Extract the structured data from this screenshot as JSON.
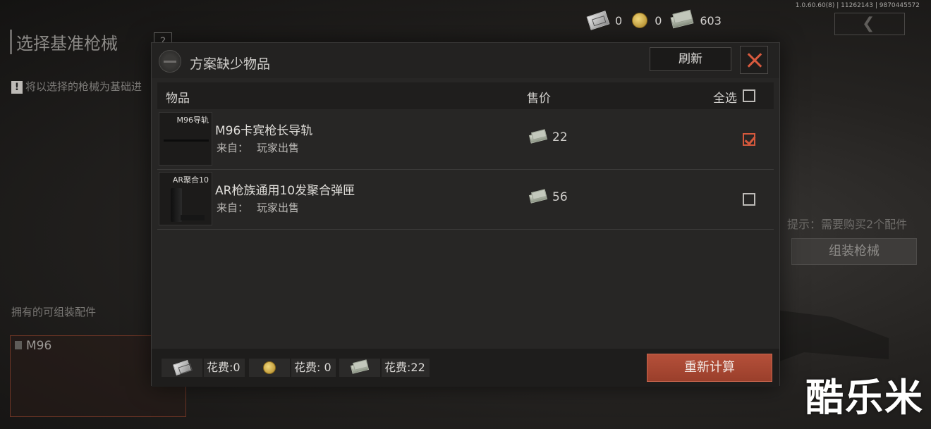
{
  "version": "1.0.60.60(8) | 11262143 | 9870445572",
  "background": {
    "title": "选择基准枪械",
    "help": "?",
    "note": "将以选择的枪械为基础进",
    "note_warn": "!",
    "owned_title": "拥有的可组装配件",
    "owned_card_label": "M96",
    "hint": "提示：需要购买2个配件",
    "assemble_button": "组装枪械"
  },
  "currency": [
    {
      "icon": "ticket-icon",
      "value": "0"
    },
    {
      "icon": "coin-icon",
      "value": "0"
    },
    {
      "icon": "cash-icon",
      "value": "603"
    }
  ],
  "modal": {
    "title": "方案缺少物品",
    "refresh_button": "刷新",
    "columns": {
      "item": "物品",
      "price": "售价",
      "select_all": "全选"
    },
    "select_all_checked": false,
    "rows": [
      {
        "thumb_tag": "M96导轨",
        "name": "M96卡宾枪长导轨",
        "source_label": "来自：",
        "source": "玩家出售",
        "price": "22",
        "checked": true
      },
      {
        "thumb_tag": "AR聚合10",
        "name": "AR枪族通用10发聚合弹匣",
        "source_label": "来自：",
        "source": "玩家出售",
        "price": "56",
        "checked": false
      }
    ],
    "costs": [
      {
        "icon": "ticket-icon",
        "label": "花费:0"
      },
      {
        "icon": "coin-icon",
        "label": "花费: 0"
      },
      {
        "icon": "cash-icon",
        "label": "花费:22"
      }
    ],
    "recalc_button": "重新计算"
  },
  "watermark": "酷乐米",
  "colors": {
    "accent": "#d4583c",
    "button_primary": "#a6452f"
  }
}
